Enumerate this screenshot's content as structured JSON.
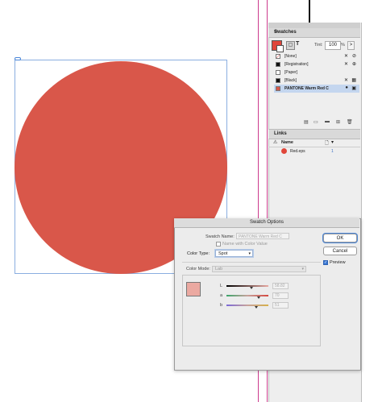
{
  "colors": {
    "circle_fill": "#d9574a",
    "pantone_swatch": "#d9574a",
    "preview_swatch": "#eba9a1",
    "selection_highlight": "#c4d6ef"
  },
  "swatches_panel": {
    "title": "Swatches",
    "tint_label": "Tint:",
    "tint_value": "100",
    "tint_unit": "%",
    "tint_arrow": ">",
    "menu_icon": "≡",
    "items": [
      {
        "name": "[None]",
        "chip": "#ffffff",
        "icon1": "✕",
        "icon2": "⊘"
      },
      {
        "name": "[Registration]",
        "chip": "#111111",
        "icon1": "✕",
        "icon2": "⊕"
      },
      {
        "name": "[Paper]",
        "chip": "#ffffff",
        "icon1": "",
        "icon2": ""
      },
      {
        "name": "[Black]",
        "chip": "#111111",
        "icon1": "✕",
        "icon2": "▦"
      },
      {
        "name": "PANTONE Warm Red C",
        "chip": "#d9574a",
        "icon1": "●",
        "icon2": "▣"
      }
    ]
  },
  "links_panel": {
    "title": "Links",
    "warning_icon": "⚠",
    "name_header": "Name",
    "file_name": "Red.eps",
    "page_number": "1"
  },
  "swatch_options": {
    "title": "Swatch Options",
    "swatch_name_label": "Swatch Name:",
    "swatch_name_value": "PANTONE Warm Red C",
    "name_with_color_value": "Name with Color Value",
    "color_type_label": "Color Type:",
    "color_type_value": "Spot",
    "color_mode_label": "Color Mode:",
    "color_mode_value": "Lab",
    "ok_label": "OK",
    "cancel_label": "Cancel",
    "preview_label": "Preview",
    "preview_checked": "✓",
    "channels": [
      {
        "label": "L",
        "value": "58.82"
      },
      {
        "label": "a",
        "value": "70"
      },
      {
        "label": "b",
        "value": "51"
      }
    ]
  }
}
